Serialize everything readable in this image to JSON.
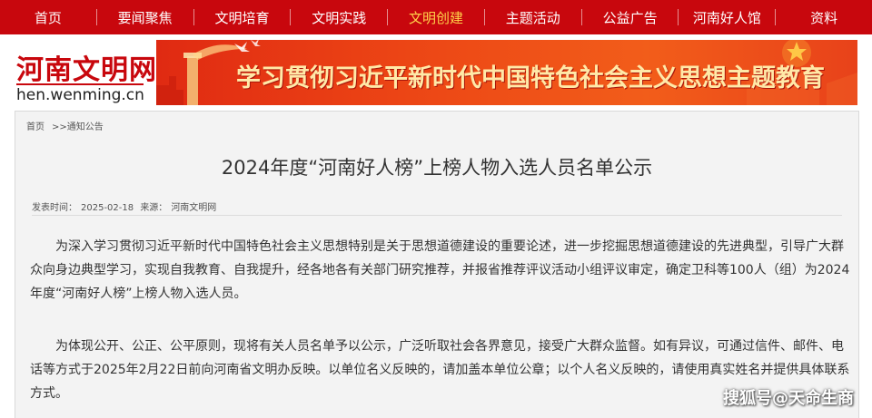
{
  "nav": {
    "items": [
      "首页",
      "要闻聚焦",
      "文明培育",
      "文明实践",
      "文明创建",
      "主题活动",
      "公益广告",
      "河南好人馆",
      "资料"
    ],
    "active_index": 4
  },
  "logo": {
    "cn": "河南文明网",
    "en": "hen.wenming.cn"
  },
  "banner": {
    "theme_text": "学习贯彻习近平新时代中国特色社会主义思想主题教育"
  },
  "breadcrumb": {
    "home": "首页",
    "section": ">>通知公告"
  },
  "article": {
    "title": "2024年度“河南好人榜”上榜人物入选人员名单公示",
    "publish_time_label": "发表时间：",
    "publish_time": "2025-02-18",
    "source_label": "来源：",
    "source": "河南文明网",
    "paragraph1": "为深入学习贯彻习近平新时代中国特色社会主义思想特别是关于思想道德建设的重要论述，进一步挖掘思想道德建设的先进典型，引导广大群众向身边典型学习，实现自我教育、自我提升，经各地各有关部门研究推荐，并报省推荐评议活动小组评议审定，确定卫科等100人（组）为2024年度“河南好人榜”上榜人物入选人员。",
    "paragraph2": "为体现公开、公正、公平原则，现将有关人员名单予以公示，广泛听取社会各界意见，接受广大群众监督。如有异议，可通过信件、邮件、电话等方式于2025年2月22日前向河南省文明办反映。以单位名义反映的，请加盖本单位公章；以个人名义反映的，请使用真实姓名并提供具体联系方式。"
  },
  "watermark": "搜狐号@天命生商",
  "colors": {
    "nav_bg": "#c8070d",
    "nav_active": "#ffd24a",
    "brand_red": "#c8070d"
  }
}
